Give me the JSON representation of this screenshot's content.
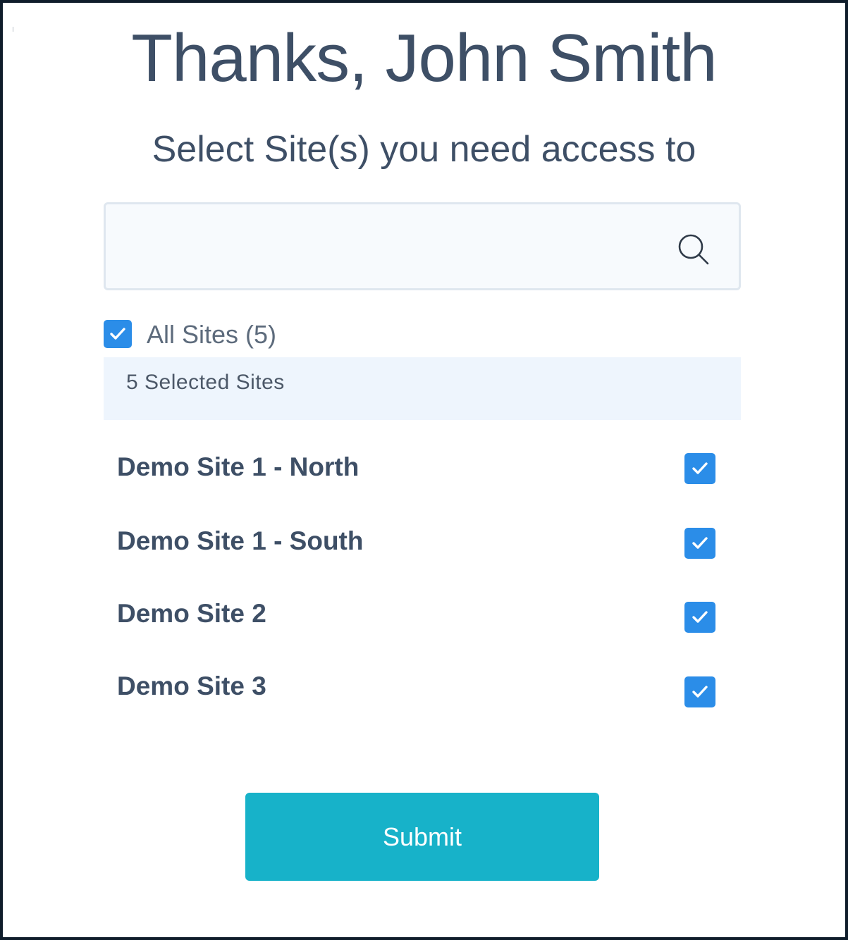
{
  "header": {
    "title": "Thanks, John Smith",
    "subtitle": "Select Site(s) you need access to"
  },
  "search": {
    "value": "",
    "placeholder": "",
    "icon": "search-icon"
  },
  "all_sites": {
    "label": "All Sites (5)",
    "checked": true
  },
  "selected_summary": {
    "label": "5 Selected Sites"
  },
  "sites": [
    {
      "name": "Demo Site 1 - North",
      "checked": true
    },
    {
      "name": "Demo Site 1 - South",
      "checked": true
    },
    {
      "name": "Demo Site 2",
      "checked": true
    },
    {
      "name": "Demo Site 3",
      "checked": true
    }
  ],
  "actions": {
    "submit_label": "Submit"
  },
  "colors": {
    "text": "#3e4f66",
    "checkbox": "#2b8de8",
    "submit": "#17b2c9",
    "selected_bg": "#eef5fd",
    "frame": "#0f1d2b"
  }
}
